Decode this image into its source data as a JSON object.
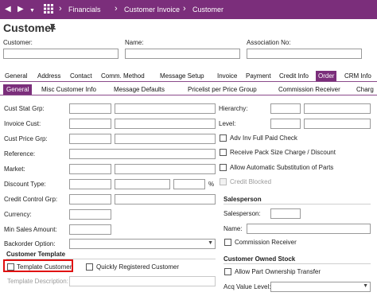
{
  "breadcrumb": {
    "items": [
      "Financials",
      "Customer Invoice",
      "Customer"
    ]
  },
  "page": {
    "title": "Customer"
  },
  "header_fields": {
    "customer_label": "Customer:",
    "name_label": "Name:",
    "association_label": "Association No:"
  },
  "tabs": [
    "General",
    "Address",
    "Contact",
    "Comm. Method",
    "Message Setup",
    "Invoice",
    "Payment",
    "Credit Info",
    "Order",
    "CRM Info"
  ],
  "active_tab": "Order",
  "subtabs": [
    "General",
    "Misc Customer Info",
    "Message Defaults",
    "Pricelist per Price Group",
    "Commission Receiver",
    "Charg"
  ],
  "active_subtab": "General",
  "left_fields": {
    "cust_stat_grp": "Cust Stat Grp:",
    "invoice_cust": "Invoice Cust:",
    "cust_price_grp": "Cust Price Grp:",
    "reference": "Reference:",
    "market": "Market:",
    "discount_type": "Discount Type:",
    "percent_sign": "%",
    "credit_control_grp": "Credit Control Grp:",
    "currency": "Currency:",
    "min_sales_amount": "Min Sales Amount:",
    "backorder_option": "Backorder Option:"
  },
  "right_fields": {
    "hierarchy": "Hierarchy:",
    "level": "Level:",
    "adv_inv_full_paid_check": "Adv Inv Full Paid Check",
    "receive_pack_size": "Receive Pack Size Charge / Discount",
    "allow_auto_substitution": "Allow Automatic Substitution of Parts",
    "credit_blocked": "Credit Blocked"
  },
  "salesperson": {
    "title": "Salesperson",
    "salesperson_label": "Salesperson:",
    "name_label": "Name:",
    "commission_receiver": "Commission Receiver"
  },
  "customer_template": {
    "title": "Customer Template",
    "template_customer": "Template Customer",
    "quickly_registered": "Quickly Registered Customer",
    "template_description": "Template Description:"
  },
  "customer_owned_stock": {
    "title": "Customer Owned Stock",
    "allow_part_ownership_transfer": "Allow Part Ownership Transfer",
    "acq_value_level": "Acq Value Level:"
  },
  "colors": {
    "brand": "#7b2e7b",
    "highlight": "#e01010"
  },
  "icons": [
    "back-icon",
    "forward-icon",
    "forward-dropdown-icon",
    "app-grid-icon",
    "chevron-right-icon",
    "pin-icon",
    "dropdown-icon"
  ]
}
